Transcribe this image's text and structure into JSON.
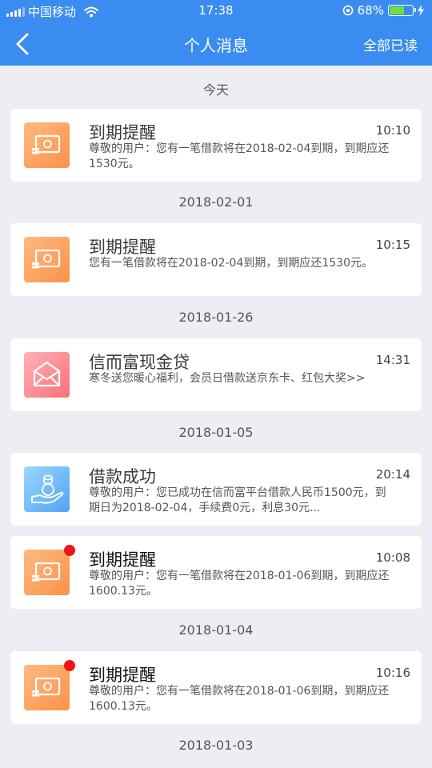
{
  "status_bar": {
    "carrier": "中国移动",
    "time": "17:38",
    "battery_percent": "68%",
    "battery_level": 0.68
  },
  "nav": {
    "title": "个人消息",
    "read_all": "全部已读"
  },
  "groups": [
    {
      "date": "今天",
      "items": [
        {
          "title": "到期提醒",
          "time": "10:10",
          "text": "尊敬的用户：您有一笔借款将在2018-02-04到期，到期应还1530元。",
          "icon": "cash-icon",
          "unread": false
        }
      ]
    },
    {
      "date": "2018-02-01",
      "items": [
        {
          "title": "到期提醒",
          "time": "10:15",
          "text": "您有一笔借款将在2018-02-04到期，到期应还1530元。",
          "icon": "cash-icon",
          "unread": false
        }
      ]
    },
    {
      "date": "2018-01-26",
      "items": [
        {
          "title": "信而富现金贷",
          "time": "14:31",
          "text": "寒冬送您暖心福利，会员日借款送京东卡、红包大奖>>",
          "icon": "envelope-icon",
          "unread": false
        }
      ]
    },
    {
      "date": "2018-01-05",
      "items": [
        {
          "title": "借款成功",
          "time": "20:14",
          "text": "尊敬的用户：您已成功在信而富平台借款人民币1500元，到期日为2018-02-04，手续费0元，利息30元...",
          "icon": "coin-hand-icon",
          "unread": false
        },
        {
          "title": "到期提醒",
          "time": "10:08",
          "text": "尊敬的用户：您有一笔借款将在2018-01-06到期，到期应还1600.13元。",
          "icon": "cash-icon",
          "unread": true
        }
      ]
    },
    {
      "date": "2018-01-04",
      "items": [
        {
          "title": "到期提醒",
          "time": "10:16",
          "text": "尊敬的用户：您有一笔借款将在2018-01-06到期，到期应还1600.13元。",
          "icon": "cash-icon",
          "unread": true
        }
      ]
    },
    {
      "date": "2018-01-03",
      "items": []
    }
  ],
  "colors": {
    "nav_bar": "#3b8cf0",
    "page_bg": "#eceef3",
    "unread_dot": "#f21414",
    "icon_orange": "#fb9148",
    "icon_pink": "#f6707a",
    "icon_blue": "#4fa4f4"
  }
}
